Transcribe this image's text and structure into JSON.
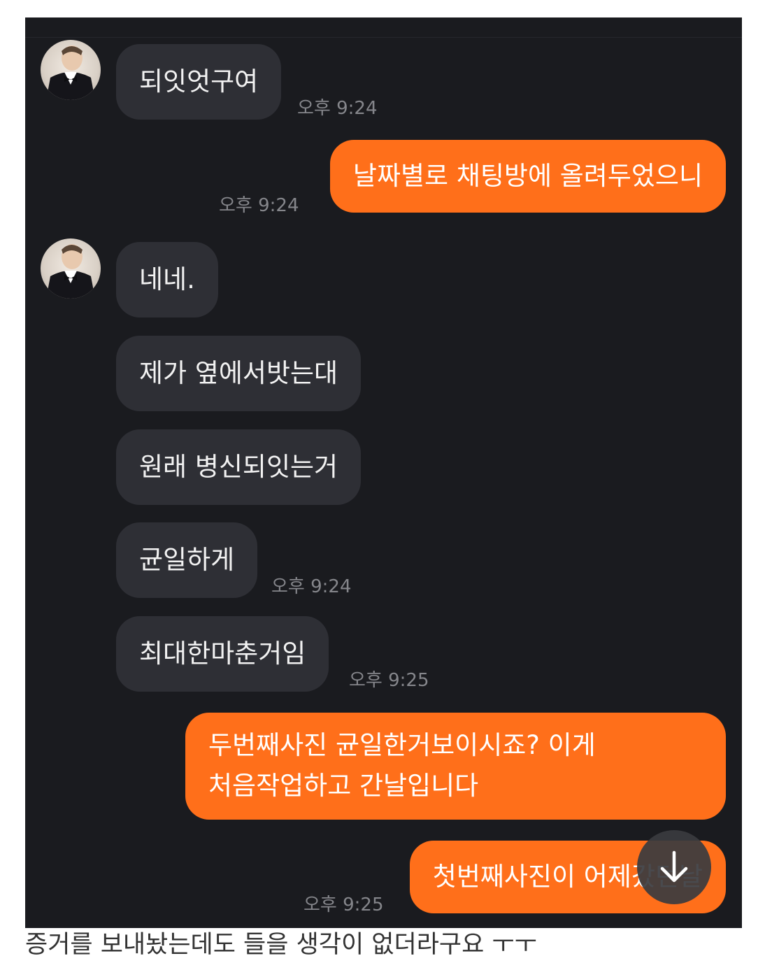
{
  "messages": [
    {
      "side": "in",
      "text": "되잇엇구여",
      "time": "오후 9:24"
    },
    {
      "side": "out",
      "text": "날짜별로 채팅방에 올려두었으니",
      "time": "오후 9:24"
    },
    {
      "side": "in",
      "text": "네네.",
      "time": ""
    },
    {
      "side": "in",
      "text": "제가 옆에서밧는대",
      "time": ""
    },
    {
      "side": "in",
      "text": "원래 병신되잇는거",
      "time": ""
    },
    {
      "side": "in",
      "text": "균일하게",
      "time": "오후 9:24"
    },
    {
      "side": "in",
      "text": "최대한마춘거임",
      "time": "오후 9:25"
    },
    {
      "side": "out",
      "lines": [
        "두번째사진 균일한거보이시죠? 이게",
        "처음작업하고 간날입니다"
      ],
      "time": ""
    },
    {
      "side": "out",
      "text": "첫번째사진이 어제갔던날",
      "time": "오후 9:25"
    }
  ],
  "scroll_button_icon": "arrow-down-icon",
  "caption": "증거를 보내놨는데도 들을 생각이 없더라구요 ㅜㅜ",
  "colors": {
    "background": "#1a1b1f",
    "incoming_bubble": "#2e2f35",
    "outgoing_bubble": "#ff6f1a",
    "timestamp": "#85868b"
  }
}
